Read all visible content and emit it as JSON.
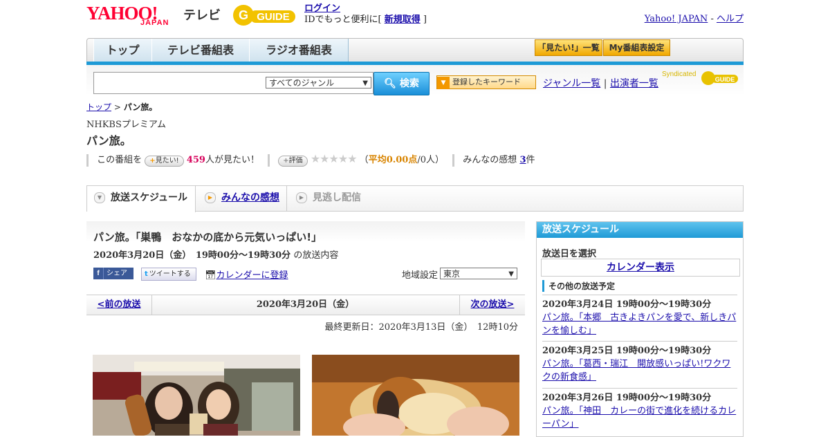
{
  "header": {
    "yahoo_logo": "YAHOO!",
    "japan_logo": "JAPAN",
    "tv_label": "テレビ",
    "guide_logo": "GUIDE",
    "login_link": "ログイン",
    "login_text_prefix": "IDでもっと便利に[ ",
    "signup_link": "新規取得",
    "login_text_suffix": " ]",
    "yahoo_japan_link": "Yahoo! JAPAN",
    "link_sep": " - ",
    "help_link": "ヘルプ"
  },
  "nav": {
    "tabs": [
      "トップ",
      "テレビ番組表",
      "ラジオ番組表"
    ],
    "want_list_btn": "「見たい!」一覧",
    "my_schedule_btn": "My番組表設定"
  },
  "search": {
    "query": "",
    "genre_selected": "すべてのジャンル",
    "search_btn": "検索",
    "keyword_btn": "登録したキーワード",
    "genre_list_link": "ジャンル一覧",
    "sep": "|",
    "performer_list_link": "出演者一覧",
    "syndicated": "Syndicated"
  },
  "breadcrumb": {
    "top": "トップ",
    "sep": " > ",
    "current": "パン旅。"
  },
  "program": {
    "channel": "NHKBSプレミアム",
    "title": "パン旅。",
    "want_prefix": "この番組を",
    "want_pill": "見たい!",
    "want_count": "459",
    "want_suffix": "人が見たい！",
    "rate_pill": "評価",
    "stars": "★★★★★",
    "rating_open": "（",
    "rating_avg": "平均0.00点",
    "rating_count": "/0人）",
    "reviews_label": "みんなの感想",
    "reviews_count": "3",
    "reviews_unit": "件"
  },
  "subtabs": [
    "放送スケジュール",
    "みんなの感想",
    "見逃し配信"
  ],
  "episode": {
    "title": "パン旅。「巣鴨　おなかの底から元気いっぱい!」",
    "date_bold": "2020年3月20日（金）　19時00分～19時30分",
    "date_suffix": " の放送内容",
    "fb_icon": "f",
    "fb_label": "シェア",
    "tw_icon": "t",
    "tw_label": "ツイートする",
    "calendar_link": "カレンダーに登録",
    "region_label": "地域設定",
    "region_selected": "東京"
  },
  "pager": {
    "prev": "<前の放送",
    "current": "2020年3月20日（金）",
    "next": "次の放送>"
  },
  "last_updated": "最終更新日：2020年3月13日（金）　12時10分",
  "sidebar": {
    "heading": "放送スケジュール",
    "select_date": "放送日を選択",
    "calendar_btn": "カレンダー表示",
    "other_heading": "その他の放送予定",
    "items": [
      {
        "date": "2020年3月24日  19時00分～19時30分",
        "title": "パン旅。「本郷　古きよきパンを愛で、新しきパンを愉しむ」"
      },
      {
        "date": "2020年3月25日  19時00分～19時30分",
        "title": "パン旅。「葛西・瑞江　開放感いっぱい!ワクワクの新食感」"
      },
      {
        "date": "2020年3月26日  19時00分～19時30分",
        "title": "パン旅。「神田　カレーの街で進化を続けるカレーパン」"
      }
    ]
  },
  "colors": {
    "accent_blue": "#1f9ad6",
    "brand_red": "#ff0033",
    "want_pink": "#d6005a",
    "rating_orange": "#d88400"
  }
}
